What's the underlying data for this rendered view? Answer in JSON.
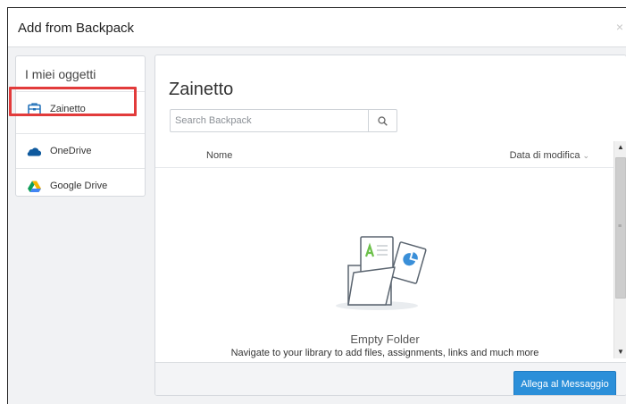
{
  "dialog": {
    "title": "Add from Backpack",
    "close_label": "×"
  },
  "sidebar": {
    "heading": "I miei oggetti",
    "items": [
      {
        "label": "Zainetto",
        "icon": "backpack-icon",
        "selected": true
      },
      {
        "label": "OneDrive",
        "icon": "onedrive-cloud-icon"
      },
      {
        "label": "Google Drive",
        "icon": "google-drive-icon"
      }
    ]
  },
  "main": {
    "title": "Zainetto",
    "search": {
      "placeholder": "Search Backpack",
      "value": ""
    },
    "columns": {
      "name": "Nome",
      "date": "Data di modifica"
    },
    "empty": {
      "title": "Empty Folder",
      "message": "Navigate to your library to add files, assignments, links and much more"
    }
  },
  "footer": {
    "attach_label": "Allega al Messaggio"
  },
  "colors": {
    "accent": "#2b8fd9",
    "highlight": "#e23b3b",
    "onedrive": "#0f6cbd",
    "empty_icon_green": "#6cc04a",
    "empty_icon_blue": "#3a8fd8"
  }
}
